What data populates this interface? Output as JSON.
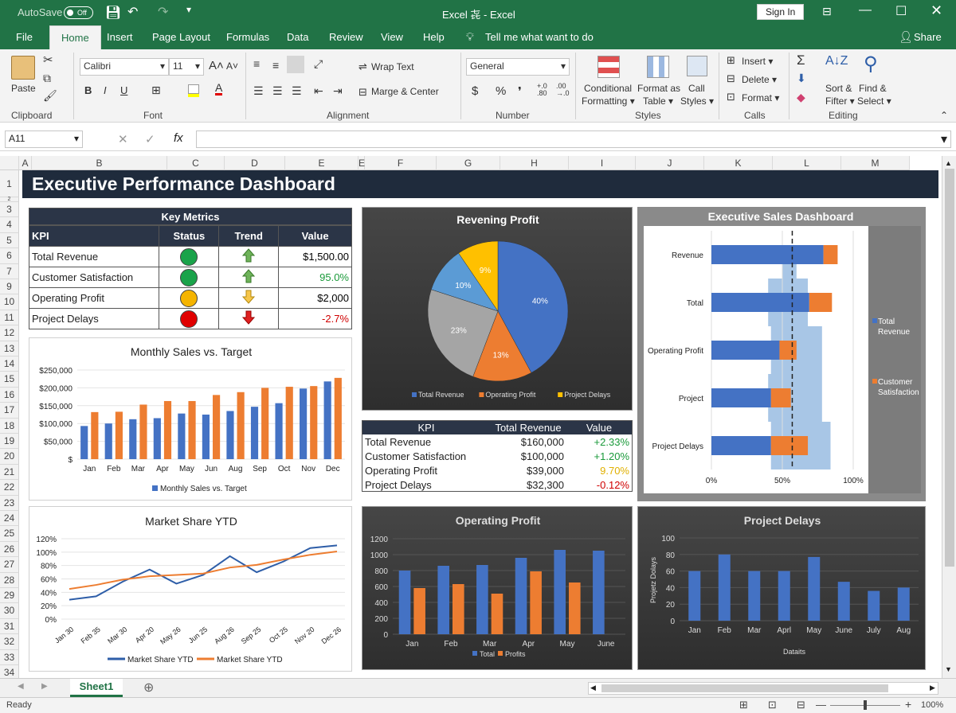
{
  "titlebar": {
    "autosave": "AutoSave",
    "autosave_state": "Off",
    "title": "Excel⁠ 㐂 - Excel",
    "sign_in": "Sign In"
  },
  "tabs": [
    {
      "label": "File"
    },
    {
      "label": "Home"
    },
    {
      "label": "Insert"
    },
    {
      "label": "Page Layout"
    },
    {
      "label": "Formulas"
    },
    {
      "label": "Data"
    },
    {
      "label": "Review"
    },
    {
      "label": "View"
    },
    {
      "label": "Help"
    }
  ],
  "tell_me": "Tell me what want to do",
  "share": "Share",
  "ribbon": {
    "paste": "Paste",
    "clipboard": "Clipboard",
    "font_name": "Calibri",
    "font_size": "11",
    "font": "Font",
    "bold": "B",
    "italic": "I",
    "underline": "U",
    "wrap_text": "Wrap Text",
    "merge_center": "Marge & Center",
    "alignment": "Alignment",
    "number_format": "General",
    "number": "Number",
    "currency": "$",
    "percent": "%",
    "comma": "❜",
    "cond_format": "Conditional",
    "cond_format2": "Formatting",
    "format_table": "Format as",
    "format_table2": "Table",
    "cell_styles": "Call",
    "cell_styles2": "Styles",
    "styles": "Styles",
    "insert": "Insert",
    "delete": "Delete",
    "format": "Format",
    "calls": "Calls",
    "sort": "Sort &",
    "sort2": "Fifter",
    "find": "Find &",
    "find2": "Select",
    "editing": "Editing"
  },
  "formula_bar": {
    "name_box": "A11",
    "value": ""
  },
  "columns": [
    "A",
    "A",
    "B",
    "C",
    "D",
    "E",
    "E",
    "F",
    "G",
    "H",
    "I",
    "J",
    "K",
    "L",
    "M"
  ],
  "rows": [
    "1",
    "2",
    "3",
    "4",
    "5",
    "6",
    "7",
    "9",
    "10",
    "11",
    "12",
    "13",
    "14",
    "15",
    "16",
    "17",
    "18",
    "19",
    "20",
    "21",
    "22",
    "23",
    "24",
    "25",
    "26",
    "27",
    "28",
    "29",
    "30",
    "31",
    "32",
    "33",
    "34"
  ],
  "dashboard_title": "Executive Performance Dashboard",
  "key_metrics": {
    "title": "Key Metrics",
    "headers": [
      "KPI",
      "Status",
      "Trend",
      "Value"
    ],
    "rows": [
      {
        "kpi": "Total Revenue",
        "status": "#1aa34a",
        "trend": "up",
        "value": "$1,500.00",
        "value_color": "#000000"
      },
      {
        "kpi": "Customer Satisfaction",
        "status": "#1aa34a",
        "trend": "up",
        "value": "95.0%",
        "value_color": "#1a9a3a"
      },
      {
        "kpi": "Operating Profit",
        "status": "#f5b400",
        "trend": "down-yellow",
        "value": "$2,000",
        "value_color": "#000000"
      },
      {
        "kpi": "Project Delays",
        "status": "#e00000",
        "trend": "down-red",
        "value": "-2.7%",
        "value_color": "#d00000"
      }
    ]
  },
  "kpi_table2": {
    "headers": [
      "KPI",
      "Total Revenue",
      "Value"
    ],
    "rows": [
      {
        "kpi": "Total Revenue",
        "rev": "$160,000",
        "val": "+2.33%",
        "color": "#1a9a3a"
      },
      {
        "kpi": "Customer Satisfaction",
        "rev": "$100,000",
        "val": "+1.20%",
        "color": "#1a9a3a"
      },
      {
        "kpi": "Operating Profit",
        "rev": "$39,000",
        "val": "9.70%",
        "color": "#e0b000"
      },
      {
        "kpi": "Project Delays",
        "rev": "$32,300",
        "val": "-0.12%",
        "color": "#d00000"
      }
    ]
  },
  "sheet_tab": "Sheet1",
  "status": {
    "ready": "Ready",
    "zoom": "100%"
  },
  "chart_data": [
    {
      "type": "bar",
      "title": "Monthly Sales vs. Target",
      "categories": [
        "Jan",
        "Feb",
        "Mar",
        "Apr",
        "May",
        "Jun",
        "Aug",
        "Sep",
        "Oct",
        "Nov",
        "Dec"
      ],
      "yticks": [
        "$",
        "$50,000",
        "$100,000",
        "$150,000",
        "$200,000",
        "$250,000"
      ],
      "ylim": [
        0,
        250000
      ],
      "series": [
        {
          "name": "Monthly Sales vs. Target",
          "color": "#4472c4",
          "values": [
            93000,
            100000,
            112000,
            115000,
            128000,
            125000,
            135000,
            147000,
            157000,
            198000,
            218000
          ]
        },
        {
          "values": [
            132000,
            133000,
            153000,
            163000,
            163000,
            180000,
            188000,
            200000,
            203000,
            205000,
            228000
          ],
          "color": "#ed7d31"
        }
      ],
      "legend": [
        "Monthly Sales vs. Target"
      ]
    },
    {
      "type": "pie",
      "title": "Revening Profit",
      "slices": [
        {
          "label": "40%",
          "value": 40,
          "color": "#4472c4"
        },
        {
          "label": "13%",
          "value": 13,
          "color": "#ed7d31"
        },
        {
          "label": "23%",
          "value": 23,
          "color": "#a5a5a5"
        },
        {
          "label": "10%",
          "value": 10,
          "color": "#5b9bd5"
        },
        {
          "label": "9%",
          "value": 9,
          "color": "#ffc000"
        }
      ],
      "legend": [
        {
          "name": "Total Revenue",
          "color": "#4472c4"
        },
        {
          "name": "Operating Profit",
          "color": "#ed7d31"
        },
        {
          "name": "Project Delays",
          "color": "#ffc000"
        }
      ]
    },
    {
      "type": "bar",
      "title": "Executive Sales Dashboard",
      "orientation": "horizontal",
      "categories": [
        "Revenue",
        "Total",
        "Operating Profit",
        "Project",
        "Project Delays"
      ],
      "xticks": [
        "0%",
        "50%",
        "100%"
      ],
      "xlim": [
        0,
        100
      ],
      "series": [
        {
          "name": "Total Revenue",
          "color": "#4472c4",
          "values": [
            79,
            69,
            48,
            42,
            42
          ]
        },
        {
          "name": "Customer Satisfaction",
          "color": "#ed7d31",
          "values": [
            10,
            16,
            12,
            14,
            26
          ]
        }
      ],
      "target_line": 57,
      "legend": [
        "Total Revenue",
        "Customer Satisfaction"
      ]
    },
    {
      "type": "line",
      "title": "Market Share YTD",
      "categories": [
        "Jan 30",
        "Feb 35",
        "Mar 30",
        "Apr 20",
        "May 26",
        "Jun 25",
        "Aug 26",
        "Sep 25",
        "Oct 25",
        "Nov 20",
        "Dec 26"
      ],
      "yticks": [
        "0%",
        "20%",
        "40%",
        "60%",
        "80%",
        "100%",
        "120%"
      ],
      "ylim": [
        0,
        120
      ],
      "series": [
        {
          "name": "Market Share YTD",
          "color": "#2e5ea8",
          "values": [
            29,
            34,
            56,
            74,
            53,
            66,
            94,
            70,
            86,
            106,
            110
          ]
        },
        {
          "name": "Market Share YTD",
          "color": "#ed7d31",
          "values": [
            45,
            51,
            59,
            64,
            66,
            68,
            77,
            81,
            89,
            96,
            101
          ]
        }
      ]
    },
    {
      "type": "bar",
      "title": "Operating Profit",
      "categories": [
        "Jan",
        "Feb",
        "Mar",
        "Apr",
        "May",
        "June"
      ],
      "yticks": [
        "0",
        "200",
        "400",
        "600",
        "800",
        "1000",
        "1200"
      ],
      "ylim": [
        0,
        1200
      ],
      "series": [
        {
          "name": "Total",
          "color": "#4472c4",
          "values": [
            800,
            860,
            870,
            960,
            1060,
            1050
          ]
        },
        {
          "name": "Profits",
          "color": "#ed7d31",
          "values": [
            580,
            630,
            510,
            790,
            650,
            0
          ]
        }
      ]
    },
    {
      "type": "bar",
      "title": "Project Delays",
      "categories": [
        "Jan",
        "Feb",
        "Mar",
        "Aprl",
        "May",
        "June",
        "July",
        "Aug"
      ],
      "yticks": [
        "0",
        "20",
        "40",
        "60",
        "80",
        "100"
      ],
      "ylim": [
        0,
        100
      ],
      "ylabel": "Projetz Dolays",
      "xlabel": "Dataits",
      "series": [
        {
          "color": "#4472c4",
          "values": [
            60,
            80,
            60,
            60,
            77,
            47,
            36,
            40
          ]
        }
      ]
    }
  ]
}
